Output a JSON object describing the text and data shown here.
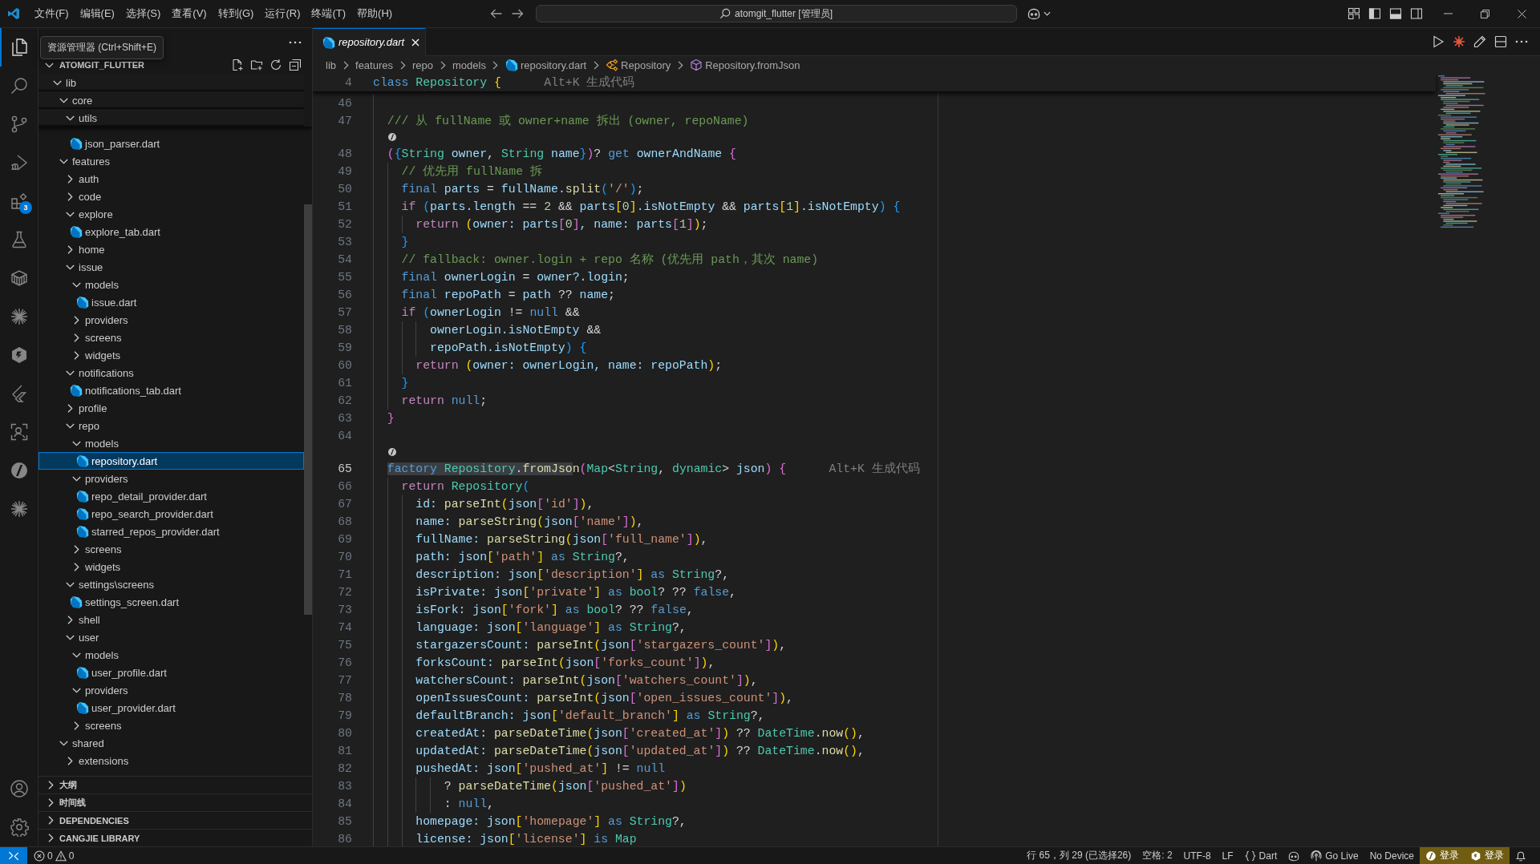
{
  "title_bar": {
    "menus": [
      "文件(F)",
      "编辑(E)",
      "选择(S)",
      "查看(V)",
      "转到(G)",
      "运行(R)",
      "终端(T)",
      "帮助(H)"
    ],
    "command_center": "atomgit_flutter [管理员]"
  },
  "activity_bar": {
    "items": [
      {
        "kind": "files",
        "selected": true
      },
      {
        "kind": "search",
        "selected": false
      },
      {
        "kind": "branch",
        "selected": false
      },
      {
        "kind": "debug",
        "selected": false
      },
      {
        "kind": "blocks",
        "selected": false,
        "badge": "3"
      },
      {
        "kind": "flask",
        "selected": false
      },
      {
        "kind": "package",
        "selected": false
      },
      {
        "kind": "asterisk",
        "selected": false
      },
      {
        "kind": "hexagon",
        "selected": false
      },
      {
        "kind": "wing",
        "selected": false
      },
      {
        "kind": "scan",
        "selected": false
      },
      {
        "kind": "slashed",
        "selected": false
      },
      {
        "kind": "asterisk",
        "selected": false
      }
    ],
    "bottom": [
      {
        "kind": "account"
      },
      {
        "kind": "gear"
      }
    ]
  },
  "sidebar": {
    "tooltip": "资源管理器 (Ctrl+Shift+E)",
    "root": {
      "label": "ATOMGIT_FLUTTER",
      "expanded": true
    },
    "tree": [
      {
        "label": "lib",
        "kind": "folder",
        "expanded": true,
        "sticky": true,
        "selected": false,
        "children": [
          {
            "label": "core",
            "kind": "folder",
            "expanded": true,
            "sticky": true,
            "selected": false,
            "children": [
              {
                "label": "utils",
                "kind": "folder",
                "expanded": true,
                "sticky": true,
                "selected": false,
                "children": [
                  {
                    "label": "json_parser.dart",
                    "kind": "file",
                    "selected": false
                  }
                ]
              }
            ]
          },
          {
            "label": "features",
            "kind": "folder",
            "expanded": true,
            "sticky": false,
            "selected": false,
            "children": [
              {
                "label": "auth",
                "kind": "folder",
                "expanded": false,
                "selected": false
              },
              {
                "label": "code",
                "kind": "folder",
                "expanded": false,
                "selected": false
              },
              {
                "label": "explore",
                "kind": "folder",
                "expanded": true,
                "selected": false,
                "children": [
                  {
                    "label": "explore_tab.dart",
                    "kind": "file",
                    "selected": false
                  }
                ]
              },
              {
                "label": "home",
                "kind": "folder",
                "expanded": false,
                "selected": false
              },
              {
                "label": "issue",
                "kind": "folder",
                "expanded": true,
                "selected": false,
                "children": [
                  {
                    "label": "models",
                    "kind": "folder",
                    "expanded": true,
                    "selected": false,
                    "children": [
                      {
                        "label": "issue.dart",
                        "kind": "file",
                        "selected": false
                      }
                    ]
                  },
                  {
                    "label": "providers",
                    "kind": "folder",
                    "expanded": false,
                    "selected": false
                  },
                  {
                    "label": "screens",
                    "kind": "folder",
                    "expanded": false,
                    "selected": false
                  },
                  {
                    "label": "widgets",
                    "kind": "folder",
                    "expanded": false,
                    "selected": false
                  }
                ]
              },
              {
                "label": "notifications",
                "kind": "folder",
                "expanded": true,
                "selected": false,
                "children": [
                  {
                    "label": "notifications_tab.dart",
                    "kind": "file",
                    "selected": false
                  }
                ]
              },
              {
                "label": "profile",
                "kind": "folder",
                "expanded": false,
                "selected": false
              },
              {
                "label": "repo",
                "kind": "folder",
                "expanded": true,
                "selected": false,
                "children": [
                  {
                    "label": "models",
                    "kind": "folder",
                    "expanded": true,
                    "selected": false,
                    "children": [
                      {
                        "label": "repository.dart",
                        "kind": "file",
                        "selected": true
                      }
                    ]
                  },
                  {
                    "label": "providers",
                    "kind": "folder",
                    "expanded": true,
                    "selected": false,
                    "children": [
                      {
                        "label": "repo_detail_provider.dart",
                        "kind": "file",
                        "selected": false
                      },
                      {
                        "label": "repo_search_provider.dart",
                        "kind": "file",
                        "selected": false
                      },
                      {
                        "label": "starred_repos_provider.dart",
                        "kind": "file",
                        "selected": false
                      }
                    ]
                  },
                  {
                    "label": "screens",
                    "kind": "folder",
                    "expanded": false,
                    "selected": false
                  },
                  {
                    "label": "widgets",
                    "kind": "folder",
                    "expanded": false,
                    "selected": false
                  }
                ]
              },
              {
                "label": "settings\\screens",
                "kind": "folder",
                "expanded": true,
                "selected": false,
                "children": [
                  {
                    "label": "settings_screen.dart",
                    "kind": "file",
                    "selected": false
                  }
                ]
              },
              {
                "label": "shell",
                "kind": "folder",
                "expanded": false,
                "selected": false
              },
              {
                "label": "user",
                "kind": "folder",
                "expanded": true,
                "selected": false,
                "children": [
                  {
                    "label": "models",
                    "kind": "folder",
                    "expanded": true,
                    "selected": false,
                    "children": [
                      {
                        "label": "user_profile.dart",
                        "kind": "file",
                        "selected": false
                      }
                    ]
                  },
                  {
                    "label": "providers",
                    "kind": "folder",
                    "expanded": true,
                    "selected": false,
                    "children": [
                      {
                        "label": "user_provider.dart",
                        "kind": "file",
                        "selected": false
                      }
                    ]
                  },
                  {
                    "label": "screens",
                    "kind": "folder",
                    "expanded": false,
                    "selected": false
                  }
                ]
              }
            ]
          },
          {
            "label": "shared",
            "kind": "folder",
            "expanded": true,
            "sticky": false,
            "selected": false,
            "children": [
              {
                "label": "extensions",
                "kind": "folder",
                "expanded": false,
                "selected": false
              }
            ]
          }
        ]
      }
    ],
    "panels": [
      {
        "label": "大纲",
        "expanded": false
      },
      {
        "label": "时间线",
        "expanded": false
      },
      {
        "label": "DEPENDENCIES",
        "expanded": false
      },
      {
        "label": "CANGJIE LIBRARY",
        "expanded": false
      }
    ]
  },
  "editor": {
    "tabs": [
      {
        "label": "repository.dart",
        "selected": true,
        "preview": true
      }
    ],
    "breadcrumbs": [
      {
        "label": "lib",
        "kind": "folder"
      },
      {
        "label": "features",
        "kind": "folder"
      },
      {
        "label": "repo",
        "kind": "folder"
      },
      {
        "label": "models",
        "kind": "folder"
      },
      {
        "label": "repository.dart",
        "kind": "file"
      },
      {
        "label": "Repository",
        "kind": "class"
      },
      {
        "label": "Repository.fromJson",
        "kind": "method"
      }
    ],
    "sticky_line": {
      "number": "4",
      "tokens": [
        {
          "text": "class ",
          "kind": "kw"
        },
        {
          "text": "Repository ",
          "kind": "type"
        },
        {
          "text": "{",
          "kind": "b1"
        }
      ],
      "hint": "Alt+K 生成代码"
    },
    "lines": [
      {
        "kind": "code",
        "number": "46",
        "active": false
      },
      {
        "kind": "code",
        "number": "47",
        "active": false,
        "tokens": [
          {
            "text": "  /// 从 fullName 或 owner+name 拆出 (owner, repoName)",
            "kind": "cmt"
          }
        ]
      },
      {
        "kind": "codelens"
      },
      {
        "kind": "code",
        "number": "48",
        "active": false,
        "tokens": [
          {
            "text": "  (",
            "kind": "b2"
          },
          {
            "text": "{",
            "kind": "b3"
          },
          {
            "text": "String ",
            "kind": "type"
          },
          {
            "text": "owner",
            "kind": "var"
          },
          {
            "text": ", ",
            "kind": "op"
          },
          {
            "text": "String ",
            "kind": "type"
          },
          {
            "text": "name",
            "kind": "var"
          },
          {
            "text": "}",
            "kind": "b3"
          },
          {
            "text": ")",
            "kind": "b2"
          },
          {
            "text": "? ",
            "kind": "op"
          },
          {
            "text": "get ",
            "kind": "kw"
          },
          {
            "text": "ownerAndName ",
            "kind": "var"
          },
          {
            "text": "{",
            "kind": "b2"
          }
        ]
      },
      {
        "kind": "code",
        "number": "49",
        "active": false,
        "tokens": [
          {
            "text": "    // 优先用 fullName 拆",
            "kind": "cmt"
          }
        ]
      },
      {
        "kind": "code",
        "number": "50",
        "active": false,
        "tokens": [
          {
            "text": "    final ",
            "kind": "kw"
          },
          {
            "text": "parts",
            "kind": "var"
          },
          {
            "text": " = ",
            "kind": "op"
          },
          {
            "text": "fullName.",
            "kind": "var"
          },
          {
            "text": "split",
            "kind": "fn"
          },
          {
            "text": "(",
            "kind": "b3"
          },
          {
            "text": "'/'",
            "kind": "str"
          },
          {
            "text": ")",
            "kind": "b3"
          },
          {
            "text": ";",
            "kind": "op"
          }
        ]
      },
      {
        "kind": "code",
        "number": "51",
        "active": false,
        "tokens": [
          {
            "text": "    if ",
            "kind": "ctl"
          },
          {
            "text": "(",
            "kind": "b3"
          },
          {
            "text": "parts.length",
            "kind": "var"
          },
          {
            "text": " == ",
            "kind": "op"
          },
          {
            "text": "2",
            "kind": "num"
          },
          {
            "text": " && ",
            "kind": "op"
          },
          {
            "text": "parts",
            "kind": "var"
          },
          {
            "text": "[",
            "kind": "b1"
          },
          {
            "text": "0",
            "kind": "num"
          },
          {
            "text": "]",
            "kind": "b1"
          },
          {
            "text": ".isNotEmpty",
            "kind": "var"
          },
          {
            "text": " && ",
            "kind": "op"
          },
          {
            "text": "parts",
            "kind": "var"
          },
          {
            "text": "[",
            "kind": "b1"
          },
          {
            "text": "1",
            "kind": "num"
          },
          {
            "text": "]",
            "kind": "b1"
          },
          {
            "text": ".isNotEmpty",
            "kind": "var"
          },
          {
            "text": ") {",
            "kind": "b3"
          }
        ]
      },
      {
        "kind": "code",
        "number": "52",
        "active": false,
        "tokens": [
          {
            "text": "      return ",
            "kind": "ctl"
          },
          {
            "text": "(",
            "kind": "b1"
          },
          {
            "text": "owner: parts",
            "kind": "var"
          },
          {
            "text": "[",
            "kind": "b2"
          },
          {
            "text": "0",
            "kind": "num"
          },
          {
            "text": "]",
            "kind": "b2"
          },
          {
            "text": ", name: parts",
            "kind": "var"
          },
          {
            "text": "[",
            "kind": "b2"
          },
          {
            "text": "1",
            "kind": "num"
          },
          {
            "text": "]",
            "kind": "b2"
          },
          {
            "text": ")",
            "kind": "b1"
          },
          {
            "text": ";",
            "kind": "op"
          }
        ]
      },
      {
        "kind": "code",
        "number": "53",
        "active": false,
        "tokens": [
          {
            "text": "    }",
            "kind": "b3"
          }
        ]
      },
      {
        "kind": "code",
        "number": "54",
        "active": false,
        "tokens": [
          {
            "text": "    // fallback: owner.login + repo 名称 (优先用 path，其次 name)",
            "kind": "cmt"
          }
        ]
      },
      {
        "kind": "code",
        "number": "55",
        "active": false,
        "tokens": [
          {
            "text": "    final ",
            "kind": "kw"
          },
          {
            "text": "ownerLogin",
            "kind": "var"
          },
          {
            "text": " = ",
            "kind": "op"
          },
          {
            "text": "owner?.login",
            "kind": "var"
          },
          {
            "text": ";",
            "kind": "op"
          }
        ]
      },
      {
        "kind": "code",
        "number": "56",
        "active": false,
        "tokens": [
          {
            "text": "    final ",
            "kind": "kw"
          },
          {
            "text": "repoPath",
            "kind": "var"
          },
          {
            "text": " = ",
            "kind": "op"
          },
          {
            "text": "path",
            "kind": "var"
          },
          {
            "text": " ?? ",
            "kind": "op"
          },
          {
            "text": "name",
            "kind": "var"
          },
          {
            "text": ";",
            "kind": "op"
          }
        ]
      },
      {
        "kind": "code",
        "number": "57",
        "active": false,
        "tokens": [
          {
            "text": "    if ",
            "kind": "ctl"
          },
          {
            "text": "(",
            "kind": "b3"
          },
          {
            "text": "ownerLogin",
            "kind": "var"
          },
          {
            "text": " != ",
            "kind": "op"
          },
          {
            "text": "null",
            "kind": "kw"
          },
          {
            "text": " &&",
            "kind": "op"
          }
        ]
      },
      {
        "kind": "code",
        "number": "58",
        "active": false,
        "tokens": [
          {
            "text": "        ownerLogin.isNotEmpty",
            "kind": "var"
          },
          {
            "text": " &&",
            "kind": "op"
          }
        ]
      },
      {
        "kind": "code",
        "number": "59",
        "active": false,
        "tokens": [
          {
            "text": "        repoPath.isNotEmpty",
            "kind": "var"
          },
          {
            "text": ") {",
            "kind": "b3"
          }
        ]
      },
      {
        "kind": "code",
        "number": "60",
        "active": false,
        "tokens": [
          {
            "text": "      return ",
            "kind": "ctl"
          },
          {
            "text": "(",
            "kind": "b1"
          },
          {
            "text": "owner: ownerLogin, name: repoPath",
            "kind": "var"
          },
          {
            "text": ")",
            "kind": "b1"
          },
          {
            "text": ";",
            "kind": "op"
          }
        ]
      },
      {
        "kind": "code",
        "number": "61",
        "active": false,
        "tokens": [
          {
            "text": "    }",
            "kind": "b3"
          }
        ]
      },
      {
        "kind": "code",
        "number": "62",
        "active": false,
        "tokens": [
          {
            "text": "    return ",
            "kind": "ctl"
          },
          {
            "text": "null",
            "kind": "kw"
          },
          {
            "text": ";",
            "kind": "op"
          }
        ]
      },
      {
        "kind": "code",
        "number": "63",
        "active": false,
        "tokens": [
          {
            "text": "  }",
            "kind": "b2"
          }
        ]
      },
      {
        "kind": "code",
        "number": "64",
        "active": false
      },
      {
        "kind": "codelens"
      },
      {
        "kind": "code",
        "number": "65",
        "active": true,
        "hint": "Alt+K 生成代码",
        "tokens": [
          {
            "text": "  factory ",
            "kind": "kw",
            "selected": true
          },
          {
            "text": "Repository",
            "kind": "type",
            "selected": true
          },
          {
            "text": ".",
            "kind": "op",
            "selected": true
          },
          {
            "text": "fromJso",
            "kind": "fn",
            "selected": true
          },
          {
            "text": "n",
            "kind": "fn",
            "selected": false
          },
          {
            "text": "(",
            "kind": "b2",
            "selected": false
          },
          {
            "text": "Map",
            "kind": "type",
            "selected": false
          },
          {
            "text": "<",
            "kind": "op",
            "selected": false
          },
          {
            "text": "String",
            "kind": "type",
            "selected": false
          },
          {
            "text": ", ",
            "kind": "op",
            "selected": false
          },
          {
            "text": "dynamic",
            "kind": "type",
            "selected": false
          },
          {
            "text": "> ",
            "kind": "op",
            "selected": false
          },
          {
            "text": "json",
            "kind": "var",
            "selected": false
          },
          {
            "text": ") {",
            "kind": "b2",
            "selected": false
          }
        ]
      },
      {
        "kind": "code",
        "number": "66",
        "active": false,
        "tokens": [
          {
            "text": "    return ",
            "kind": "ctl"
          },
          {
            "text": "Repository",
            "kind": "type"
          },
          {
            "text": "(",
            "kind": "b3"
          }
        ]
      },
      {
        "kind": "code",
        "number": "67",
        "active": false,
        "tokens": [
          {
            "text": "      id: ",
            "kind": "var"
          },
          {
            "text": "parseInt",
            "kind": "fn"
          },
          {
            "text": "(",
            "kind": "b1"
          },
          {
            "text": "json",
            "kind": "var"
          },
          {
            "text": "[",
            "kind": "b2"
          },
          {
            "text": "'id'",
            "kind": "str"
          },
          {
            "text": "]",
            "kind": "b2"
          },
          {
            "text": ")",
            "kind": "b1"
          },
          {
            "text": ",",
            "kind": "op"
          }
        ]
      },
      {
        "kind": "code",
        "number": "68",
        "active": false,
        "tokens": [
          {
            "text": "      name: ",
            "kind": "var"
          },
          {
            "text": "parseString",
            "kind": "fn"
          },
          {
            "text": "(",
            "kind": "b1"
          },
          {
            "text": "json",
            "kind": "var"
          },
          {
            "text": "[",
            "kind": "b2"
          },
          {
            "text": "'name'",
            "kind": "str"
          },
          {
            "text": "]",
            "kind": "b2"
          },
          {
            "text": ")",
            "kind": "b1"
          },
          {
            "text": ",",
            "kind": "op"
          }
        ]
      },
      {
        "kind": "code",
        "number": "69",
        "active": false,
        "tokens": [
          {
            "text": "      fullName: ",
            "kind": "var"
          },
          {
            "text": "parseString",
            "kind": "fn"
          },
          {
            "text": "(",
            "kind": "b1"
          },
          {
            "text": "json",
            "kind": "var"
          },
          {
            "text": "[",
            "kind": "b2"
          },
          {
            "text": "'full_name'",
            "kind": "str"
          },
          {
            "text": "]",
            "kind": "b2"
          },
          {
            "text": ")",
            "kind": "b1"
          },
          {
            "text": ",",
            "kind": "op"
          }
        ]
      },
      {
        "kind": "code",
        "number": "70",
        "active": false,
        "tokens": [
          {
            "text": "      path: json",
            "kind": "var"
          },
          {
            "text": "[",
            "kind": "b1"
          },
          {
            "text": "'path'",
            "kind": "str"
          },
          {
            "text": "]",
            "kind": "b1"
          },
          {
            "text": " as ",
            "kind": "kw"
          },
          {
            "text": "String",
            "kind": "type"
          },
          {
            "text": "?,",
            "kind": "op"
          }
        ]
      },
      {
        "kind": "code",
        "number": "71",
        "active": false,
        "tokens": [
          {
            "text": "      description: json",
            "kind": "var"
          },
          {
            "text": "[",
            "kind": "b1"
          },
          {
            "text": "'description'",
            "kind": "str"
          },
          {
            "text": "]",
            "kind": "b1"
          },
          {
            "text": " as ",
            "kind": "kw"
          },
          {
            "text": "String",
            "kind": "type"
          },
          {
            "text": "?,",
            "kind": "op"
          }
        ]
      },
      {
        "kind": "code",
        "number": "72",
        "active": false,
        "tokens": [
          {
            "text": "      isPrivate: json",
            "kind": "var"
          },
          {
            "text": "[",
            "kind": "b1"
          },
          {
            "text": "'private'",
            "kind": "str"
          },
          {
            "text": "]",
            "kind": "b1"
          },
          {
            "text": " as ",
            "kind": "kw"
          },
          {
            "text": "bool",
            "kind": "type"
          },
          {
            "text": "? ?? ",
            "kind": "op"
          },
          {
            "text": "false",
            "kind": "kw"
          },
          {
            "text": ",",
            "kind": "op"
          }
        ]
      },
      {
        "kind": "code",
        "number": "73",
        "active": false,
        "tokens": [
          {
            "text": "      isFork: json",
            "kind": "var"
          },
          {
            "text": "[",
            "kind": "b1"
          },
          {
            "text": "'fork'",
            "kind": "str"
          },
          {
            "text": "]",
            "kind": "b1"
          },
          {
            "text": " as ",
            "kind": "kw"
          },
          {
            "text": "bool",
            "kind": "type"
          },
          {
            "text": "? ?? ",
            "kind": "op"
          },
          {
            "text": "false",
            "kind": "kw"
          },
          {
            "text": ",",
            "kind": "op"
          }
        ]
      },
      {
        "kind": "code",
        "number": "74",
        "active": false,
        "tokens": [
          {
            "text": "      language: json",
            "kind": "var"
          },
          {
            "text": "[",
            "kind": "b1"
          },
          {
            "text": "'language'",
            "kind": "str"
          },
          {
            "text": "]",
            "kind": "b1"
          },
          {
            "text": " as ",
            "kind": "kw"
          },
          {
            "text": "String",
            "kind": "type"
          },
          {
            "text": "?,",
            "kind": "op"
          }
        ]
      },
      {
        "kind": "code",
        "number": "75",
        "active": false,
        "tokens": [
          {
            "text": "      stargazersCount: ",
            "kind": "var"
          },
          {
            "text": "parseInt",
            "kind": "fn"
          },
          {
            "text": "(",
            "kind": "b1"
          },
          {
            "text": "json",
            "kind": "var"
          },
          {
            "text": "[",
            "kind": "b2"
          },
          {
            "text": "'stargazers_count'",
            "kind": "str"
          },
          {
            "text": "]",
            "kind": "b2"
          },
          {
            "text": ")",
            "kind": "b1"
          },
          {
            "text": ",",
            "kind": "op"
          }
        ]
      },
      {
        "kind": "code",
        "number": "76",
        "active": false,
        "tokens": [
          {
            "text": "      forksCount: ",
            "kind": "var"
          },
          {
            "text": "parseInt",
            "kind": "fn"
          },
          {
            "text": "(",
            "kind": "b1"
          },
          {
            "text": "json",
            "kind": "var"
          },
          {
            "text": "[",
            "kind": "b2"
          },
          {
            "text": "'forks_count'",
            "kind": "str"
          },
          {
            "text": "]",
            "kind": "b2"
          },
          {
            "text": ")",
            "kind": "b1"
          },
          {
            "text": ",",
            "kind": "op"
          }
        ]
      },
      {
        "kind": "code",
        "number": "77",
        "active": false,
        "tokens": [
          {
            "text": "      watchersCount: ",
            "kind": "var"
          },
          {
            "text": "parseInt",
            "kind": "fn"
          },
          {
            "text": "(",
            "kind": "b1"
          },
          {
            "text": "json",
            "kind": "var"
          },
          {
            "text": "[",
            "kind": "b2"
          },
          {
            "text": "'watchers_count'",
            "kind": "str"
          },
          {
            "text": "]",
            "kind": "b2"
          },
          {
            "text": ")",
            "kind": "b1"
          },
          {
            "text": ",",
            "kind": "op"
          }
        ]
      },
      {
        "kind": "code",
        "number": "78",
        "active": false,
        "tokens": [
          {
            "text": "      openIssuesCount: ",
            "kind": "var"
          },
          {
            "text": "parseInt",
            "kind": "fn"
          },
          {
            "text": "(",
            "kind": "b1"
          },
          {
            "text": "json",
            "kind": "var"
          },
          {
            "text": "[",
            "kind": "b2"
          },
          {
            "text": "'open_issues_count'",
            "kind": "str"
          },
          {
            "text": "]",
            "kind": "b2"
          },
          {
            "text": ")",
            "kind": "b1"
          },
          {
            "text": ",",
            "kind": "op"
          }
        ]
      },
      {
        "kind": "code",
        "number": "79",
        "active": false,
        "tokens": [
          {
            "text": "      defaultBranch: json",
            "kind": "var"
          },
          {
            "text": "[",
            "kind": "b1"
          },
          {
            "text": "'default_branch'",
            "kind": "str"
          },
          {
            "text": "]",
            "kind": "b1"
          },
          {
            "text": " as ",
            "kind": "kw"
          },
          {
            "text": "String",
            "kind": "type"
          },
          {
            "text": "?,",
            "kind": "op"
          }
        ]
      },
      {
        "kind": "code",
        "number": "80",
        "active": false,
        "tokens": [
          {
            "text": "      createdAt: ",
            "kind": "var"
          },
          {
            "text": "parseDateTime",
            "kind": "fn"
          },
          {
            "text": "(",
            "kind": "b1"
          },
          {
            "text": "json",
            "kind": "var"
          },
          {
            "text": "[",
            "kind": "b2"
          },
          {
            "text": "'created_at'",
            "kind": "str"
          },
          {
            "text": "]",
            "kind": "b2"
          },
          {
            "text": ")",
            "kind": "b1"
          },
          {
            "text": " ?? ",
            "kind": "op"
          },
          {
            "text": "DateTime",
            "kind": "type"
          },
          {
            "text": ".",
            "kind": "op"
          },
          {
            "text": "now",
            "kind": "fn"
          },
          {
            "text": "()",
            "kind": "b1"
          },
          {
            "text": ",",
            "kind": "op"
          }
        ]
      },
      {
        "kind": "code",
        "number": "81",
        "active": false,
        "tokens": [
          {
            "text": "      updatedAt: ",
            "kind": "var"
          },
          {
            "text": "parseDateTime",
            "kind": "fn"
          },
          {
            "text": "(",
            "kind": "b1"
          },
          {
            "text": "json",
            "kind": "var"
          },
          {
            "text": "[",
            "kind": "b2"
          },
          {
            "text": "'updated_at'",
            "kind": "str"
          },
          {
            "text": "]",
            "kind": "b2"
          },
          {
            "text": ")",
            "kind": "b1"
          },
          {
            "text": " ?? ",
            "kind": "op"
          },
          {
            "text": "DateTime",
            "kind": "type"
          },
          {
            "text": ".",
            "kind": "op"
          },
          {
            "text": "now",
            "kind": "fn"
          },
          {
            "text": "()",
            "kind": "b1"
          },
          {
            "text": ",",
            "kind": "op"
          }
        ]
      },
      {
        "kind": "code",
        "number": "82",
        "active": false,
        "tokens": [
          {
            "text": "      pushedAt: json",
            "kind": "var"
          },
          {
            "text": "[",
            "kind": "b1"
          },
          {
            "text": "'pushed_at'",
            "kind": "str"
          },
          {
            "text": "]",
            "kind": "b1"
          },
          {
            "text": " != ",
            "kind": "op"
          },
          {
            "text": "null",
            "kind": "kw"
          }
        ]
      },
      {
        "kind": "code",
        "number": "83",
        "active": false,
        "tokens": [
          {
            "text": "          ? ",
            "kind": "op"
          },
          {
            "text": "parseDateTime",
            "kind": "fn"
          },
          {
            "text": "(",
            "kind": "b1"
          },
          {
            "text": "json",
            "kind": "var"
          },
          {
            "text": "[",
            "kind": "b2"
          },
          {
            "text": "'pushed_at'",
            "kind": "str"
          },
          {
            "text": "]",
            "kind": "b2"
          },
          {
            "text": ")",
            "kind": "b1"
          }
        ]
      },
      {
        "kind": "code",
        "number": "84",
        "active": false,
        "tokens": [
          {
            "text": "          : ",
            "kind": "op"
          },
          {
            "text": "null",
            "kind": "kw"
          },
          {
            "text": ",",
            "kind": "op"
          }
        ]
      },
      {
        "kind": "code",
        "number": "85",
        "active": false,
        "tokens": [
          {
            "text": "      homepage: json",
            "kind": "var"
          },
          {
            "text": "[",
            "kind": "b1"
          },
          {
            "text": "'homepage'",
            "kind": "str"
          },
          {
            "text": "]",
            "kind": "b1"
          },
          {
            "text": " as ",
            "kind": "kw"
          },
          {
            "text": "String",
            "kind": "type"
          },
          {
            "text": "?,",
            "kind": "op"
          }
        ]
      },
      {
        "kind": "code",
        "number": "86",
        "active": false,
        "tokens": [
          {
            "text": "      license: json",
            "kind": "var"
          },
          {
            "text": "[",
            "kind": "b1"
          },
          {
            "text": "'license'",
            "kind": "str"
          },
          {
            "text": "]",
            "kind": "b1"
          },
          {
            "text": " is ",
            "kind": "kw"
          },
          {
            "text": "Map",
            "kind": "type"
          }
        ]
      }
    ]
  },
  "status_bar": {
    "errors": "0",
    "warnings": "0",
    "items": [
      {
        "kind": "text",
        "text": "行 65，列 29 (已选择26)",
        "warning": false
      },
      {
        "kind": "text",
        "text": "空格: 2",
        "warning": false
      },
      {
        "kind": "text",
        "text": "UTF-8",
        "warning": false
      },
      {
        "kind": "text",
        "text": "LF",
        "warning": false
      },
      {
        "kind": "language",
        "text": "Dart",
        "warning": false
      },
      {
        "kind": "copilot",
        "warning": false
      },
      {
        "kind": "live",
        "text": "Go Live",
        "warning": false
      },
      {
        "kind": "text",
        "text": "No Device",
        "warning": false
      },
      {
        "kind": "slashed",
        "text": "登录",
        "warning": true
      },
      {
        "kind": "hexagon",
        "text": "登录",
        "warning": true
      },
      {
        "kind": "bell",
        "warning": false
      }
    ]
  }
}
